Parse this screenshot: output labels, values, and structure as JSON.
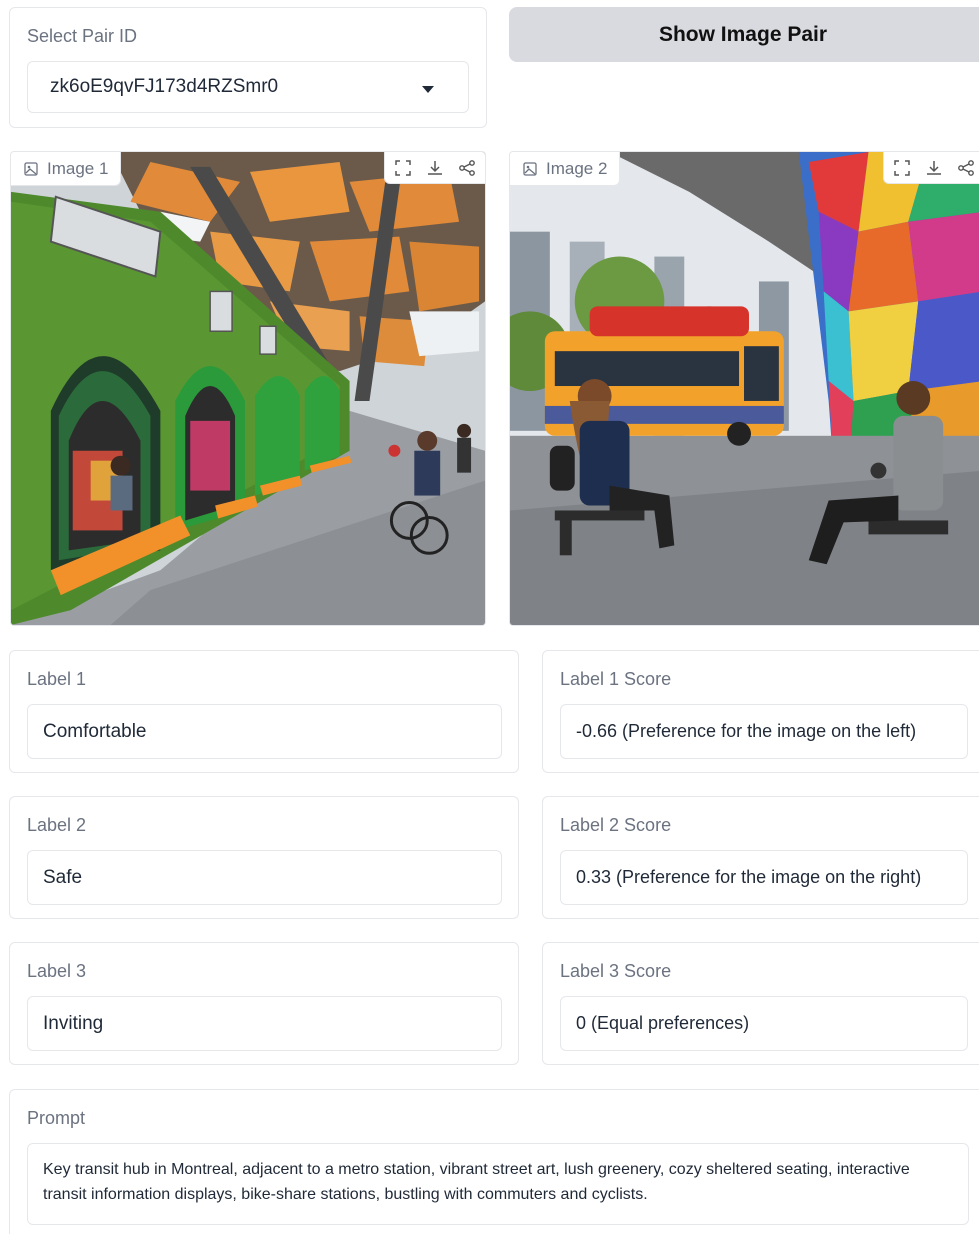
{
  "pair_select": {
    "label": "Select Pair ID",
    "value": "zk6oE9qvFJ173d4RZSmr0"
  },
  "show_button": {
    "label": "Show Image Pair"
  },
  "images": [
    {
      "tag": "Image 1"
    },
    {
      "tag": "Image 2"
    }
  ],
  "labels": [
    {
      "title": "Label 1",
      "value": "Comfortable",
      "score_title": "Label 1 Score",
      "score": "-0.66 (Preference for the image on the left)"
    },
    {
      "title": "Label 2",
      "value": "Safe",
      "score_title": "Label 2 Score",
      "score": "0.33 (Preference for the image on the right)"
    },
    {
      "title": "Label 3",
      "value": "Inviting",
      "score_title": "Label 3 Score",
      "score": "0 (Equal preferences)"
    }
  ],
  "prompt": {
    "label": "Prompt",
    "text": "Key transit hub in Montreal, adjacent to a metro station, vibrant street art, lush greenery, cozy sheltered seating, interactive transit information displays, bike-share stations, bustling with commuters and cyclists."
  },
  "colors": {
    "button_bg": "#d9dadf",
    "border": "#e5e7eb",
    "muted_text": "#6b7280"
  },
  "icons": {
    "image_tag": "image-icon",
    "tools": [
      "fullscreen-icon",
      "download-icon",
      "share-icon"
    ]
  }
}
